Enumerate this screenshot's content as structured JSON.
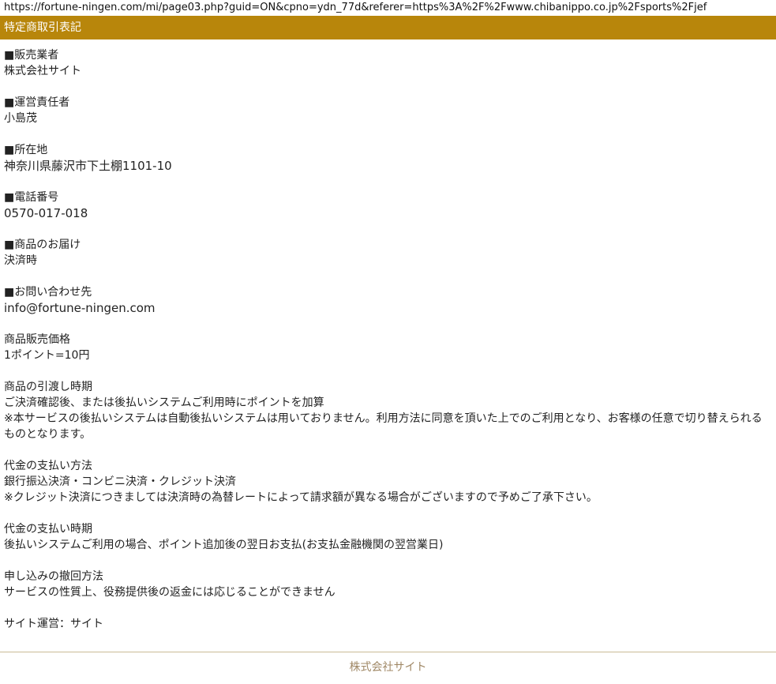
{
  "url": "https://fortune-ningen.com/mi/page03.php?guid=ON&cpno=ydn_77d&referer=https%3A%2F%2Fwww.chibanippo.co.jp%2Fsports%2Fjef",
  "header_title": "特定商取引表記",
  "sections": [
    {
      "heading": "■販売業者",
      "lines": [
        "株式会社サイト"
      ]
    },
    {
      "heading": "■運営責任者",
      "lines": [
        "小島茂"
      ]
    },
    {
      "heading": "■所在地",
      "lines": [
        "神奈川県藤沢市下土棚1101-10"
      ]
    },
    {
      "heading": "■電話番号",
      "lines": [
        "0570-017-018"
      ]
    },
    {
      "heading": "■商品のお届け",
      "lines": [
        "決済時"
      ]
    },
    {
      "heading": "■お問い合わせ先",
      "lines": [
        "info@fortune-ningen.com"
      ]
    },
    {
      "heading": "商品販売価格",
      "lines": [
        "1ポイント=10円"
      ]
    },
    {
      "heading": "商品の引渡し時期",
      "lines": [
        "ご決済確認後、または後払いシステムご利用時にポイントを加算",
        "※本サービスの後払いシステムは自動後払いシステムは用いておりません。利用方法に同意を頂いた上でのご利用となり、お客様の任意で切り替えられるものとなります。"
      ]
    },
    {
      "heading": "代金の支払い方法",
      "lines": [
        "銀行振込決済・コンビニ決済・クレジット決済",
        "※クレジット決済につきましては決済時の為替レートによって請求額が異なる場合がございますので予めご了承下さい。"
      ]
    },
    {
      "heading": "代金の支払い時期",
      "lines": [
        "後払いシステムご利用の場合、ポイント追加後の翌日お支払(お支払金融機関の翌営業日)"
      ]
    },
    {
      "heading": "申し込みの撤回方法",
      "lines": [
        "サービスの性質上、役務提供後の返金には応じることができません"
      ]
    }
  ],
  "operator_line": "サイト運営：サイト",
  "footer_text": "株式会社サイト",
  "colors": {
    "header_bg": "#b8860b",
    "footer_text": "#a08866"
  }
}
